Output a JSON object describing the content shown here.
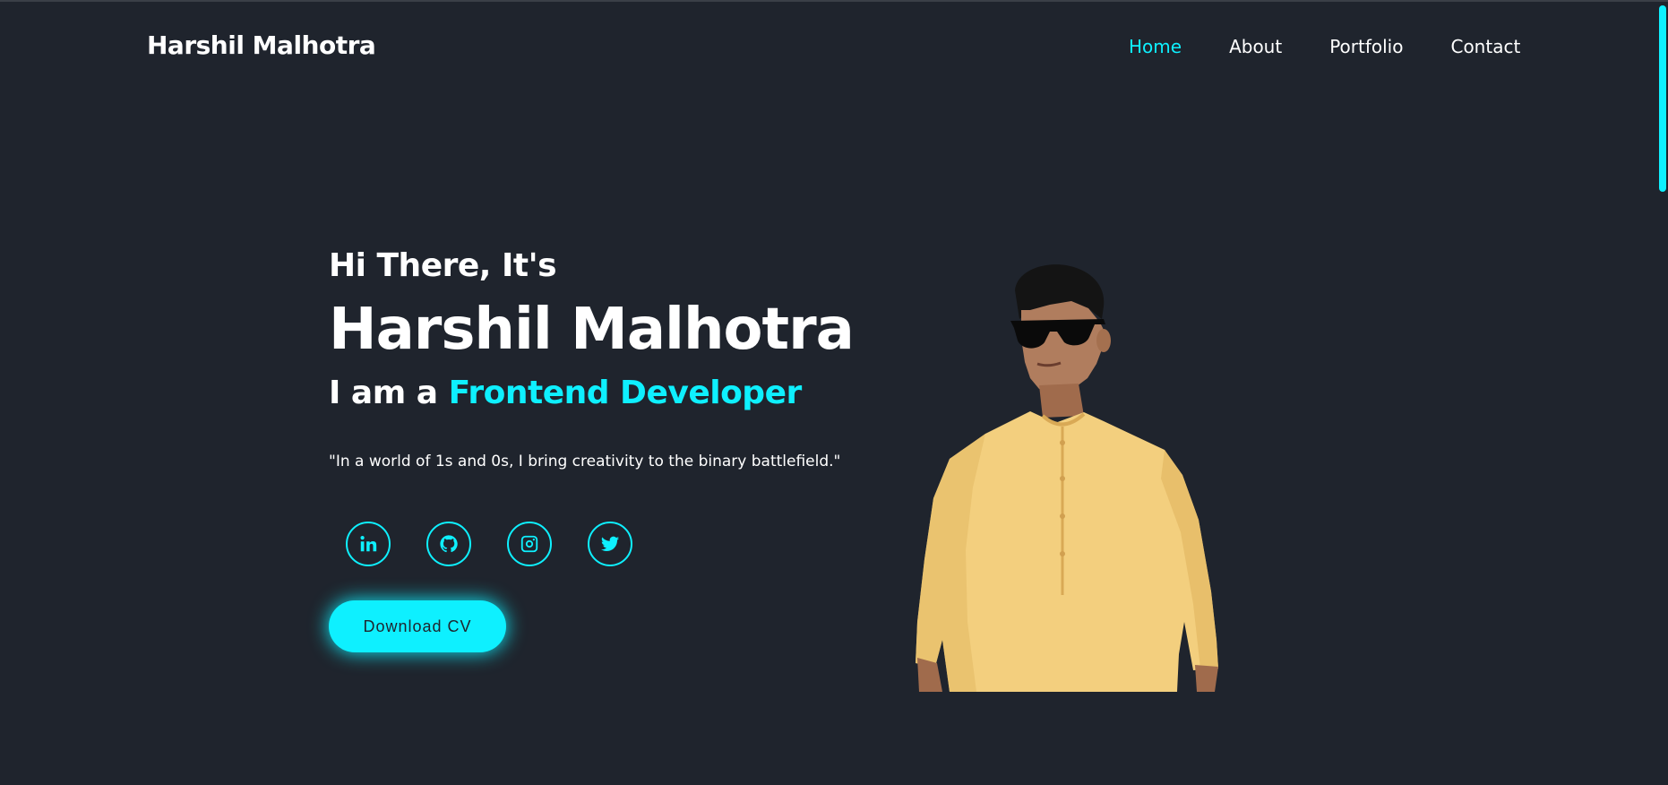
{
  "header": {
    "logo": "Harshil Malhotra",
    "nav": [
      {
        "label": "Home",
        "active": true
      },
      {
        "label": "About",
        "active": false
      },
      {
        "label": "Portfolio",
        "active": false
      },
      {
        "label": "Contact",
        "active": false
      }
    ]
  },
  "hero": {
    "greeting": "Hi There, It's",
    "name": "Harshil Malhotra",
    "role_prefix": "I am a ",
    "role_highlight": "Frontend Developer",
    "quote": "\"In a world of 1s and 0s, I bring creativity to the binary battlefield.\"",
    "socials": [
      {
        "icon": "linkedin-icon"
      },
      {
        "icon": "github-icon"
      },
      {
        "icon": "instagram-icon"
      },
      {
        "icon": "twitter-icon"
      }
    ],
    "cta_label": "Download CV"
  },
  "colors": {
    "background": "#1f242d",
    "accent": "#0ef0ff",
    "text": "#ffffff"
  }
}
